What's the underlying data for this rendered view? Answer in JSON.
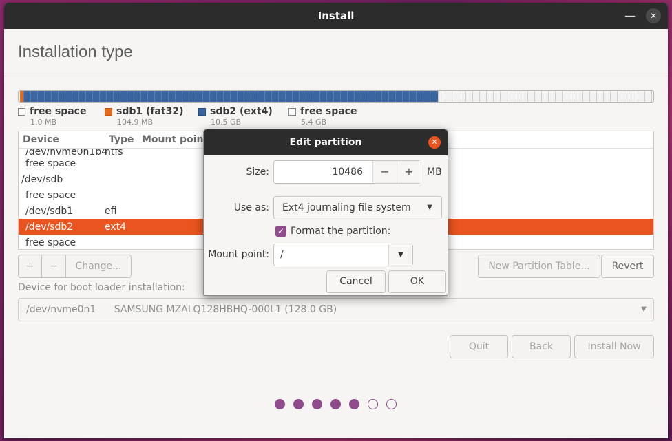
{
  "window": {
    "title": "Install",
    "minimize_symbol": "—",
    "close_symbol": "✕"
  },
  "page": {
    "title": "Installation type"
  },
  "legend": [
    {
      "name": "free space",
      "size": "1.0 MB",
      "color": "#ffffff"
    },
    {
      "name": "sdb1 (fat32)",
      "size": "104.9 MB",
      "color": "#e56a1e"
    },
    {
      "name": "sdb2 (ext4)",
      "size": "10.5 GB",
      "color": "#3b65a0"
    },
    {
      "name": "free space",
      "size": "5.4 GB",
      "color": "#ffffff"
    }
  ],
  "table": {
    "headers": {
      "device": "Device",
      "type": "Type",
      "mount": "Mount point"
    },
    "rows": [
      {
        "device": "/dev/nvme0n1p4",
        "type": "ntfs"
      },
      {
        "device": "free space",
        "type": ""
      },
      {
        "device": "/dev/sdb",
        "type": ""
      },
      {
        "device": "free space",
        "type": ""
      },
      {
        "device": "/dev/sdb1",
        "type": "efi"
      },
      {
        "device": "/dev/sdb2",
        "type": "ext4"
      },
      {
        "device": "free space",
        "type": ""
      }
    ]
  },
  "toolbar": {
    "add_label": "+",
    "remove_label": "−",
    "change_label": "Change...",
    "new_table_label": "New Partition Table...",
    "revert_label": "Revert"
  },
  "boot": {
    "label": "Device for boot loader installation:",
    "device": "/dev/nvme0n1",
    "description": "SAMSUNG MZALQ128HBHQ-000L1 (128.0 GB)"
  },
  "nav": {
    "quit_label": "Quit",
    "back_label": "Back",
    "install_label": "Install Now"
  },
  "progress": {
    "total_steps": 7,
    "completed_steps": 5
  },
  "dialog": {
    "title": "Edit partition",
    "close_symbol": "✕",
    "size_label": "Size:",
    "size_value": "10486",
    "size_unit": "MB",
    "use_as_label": "Use as:",
    "use_as_value": "Ext4 journaling file system",
    "format_label": "Format the partition:",
    "mount_label": "Mount point:",
    "mount_value": "/",
    "cancel_label": "Cancel",
    "ok_label": "OK"
  }
}
